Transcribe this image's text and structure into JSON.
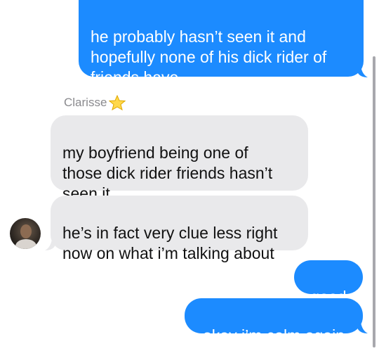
{
  "messages": [
    {
      "type": "sent",
      "text": "he probably hasn’t seen it and\nhopefully none of his dick rider of\nfriends have"
    },
    {
      "type": "received",
      "text": "my boyfriend being one of\nthose dick rider friends hasn’t\nseen it"
    },
    {
      "type": "received",
      "text": "he’s in fact very clue less right\nnow on what i’m talking about"
    },
    {
      "type": "sent",
      "text": "good"
    },
    {
      "type": "sent",
      "text": "okay i’m calm again"
    }
  ],
  "sender": {
    "name": "Clarisse",
    "badge_icon": "star-emoji-icon"
  },
  "colors": {
    "sent_bubble": "#1c8bff",
    "received_bubble": "#e9e9eb",
    "sender_name": "#8a8a8e"
  }
}
